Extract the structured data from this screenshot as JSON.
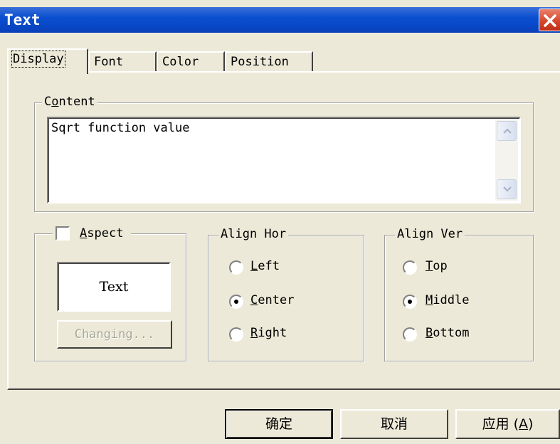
{
  "window": {
    "title": "Text"
  },
  "tabs": [
    {
      "label": "Display",
      "active": true
    },
    {
      "label": "Font",
      "active": false
    },
    {
      "label": "Color",
      "active": false
    },
    {
      "label": "Position",
      "active": false
    }
  ],
  "content_group": {
    "legend_prefix": "C",
    "legend_mnemonic": "o",
    "legend_suffix": "ntent",
    "value": "Sqrt function value"
  },
  "aspect_group": {
    "legend_mnemonic": "A",
    "legend_suffix": "spect",
    "checked": false,
    "preview_text": "Text",
    "change_button": "Changing..."
  },
  "align_hor": {
    "legend": "Align Hor",
    "options": [
      {
        "mnemonic": "L",
        "rest": "eft",
        "checked": false
      },
      {
        "mnemonic": "C",
        "rest": "enter",
        "checked": true
      },
      {
        "mnemonic": "R",
        "rest": "ight",
        "checked": false
      }
    ]
  },
  "align_ver": {
    "legend": "Align Ver",
    "options": [
      {
        "mnemonic": "T",
        "rest": "op",
        "checked": false
      },
      {
        "mnemonic": "M",
        "rest": "iddle",
        "checked": true
      },
      {
        "mnemonic": "B",
        "rest": "ottom",
        "checked": false
      }
    ]
  },
  "buttons": {
    "ok": "确定",
    "cancel": "取消",
    "apply_prefix": "应用 (",
    "apply_mnemonic": "A",
    "apply_suffix": ")"
  },
  "colors": {
    "titlebar": "#0a4fd0",
    "face": "#ece9d8",
    "close": "#d4442a"
  }
}
